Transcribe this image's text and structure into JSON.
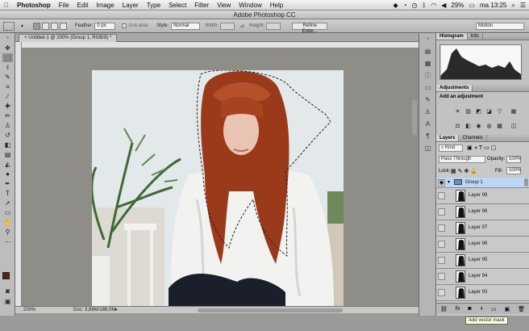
{
  "menubar": {
    "apple": "",
    "items": [
      "Photoshop",
      "File",
      "Edit",
      "Image",
      "Layer",
      "Type",
      "Select",
      "Filter",
      "View",
      "Window",
      "Help"
    ],
    "battery": "29%",
    "clock": "ma 13:25"
  },
  "window": {
    "title": "Adobe Photoshop CC"
  },
  "options": {
    "feather_label": "Feather:",
    "feather_value": "0 px",
    "antialias_label": "Anti-alias",
    "style_label": "Style:",
    "style_value": "Normal",
    "width_label": "Width:",
    "height_label": "Height:",
    "refine_edge": "Refine Edge...",
    "workspace": "Motion"
  },
  "document": {
    "tab": "Untitled-1 @ 200% (Group 1, RGB/8) *",
    "zoom": "200%",
    "doc_info": "Doc: 3,88M/186,0M"
  },
  "panels": {
    "histogram_tab": "Histogram",
    "info_tab": "Info",
    "adjustments_tab": "Adjustments",
    "adjustments_title": "Add an adjustment",
    "layers_tab": "Layers",
    "channels_tab": "Channels",
    "kind": "Kind",
    "blend_mode": "Pass Through",
    "opacity_label": "Opacity:",
    "opacity_value": "100%",
    "lock_label": "Lock:",
    "fill_label": "Fill:",
    "fill_value": "100%",
    "layers": [
      {
        "name": "Group 1",
        "selected": true
      },
      {
        "name": "Layer 99"
      },
      {
        "name": "Layer 98"
      },
      {
        "name": "Layer 97"
      },
      {
        "name": "Layer 96"
      },
      {
        "name": "Layer 95"
      },
      {
        "name": "Layer 94"
      },
      {
        "name": "Layer 93"
      }
    ]
  },
  "tooltip": "Add vector mask",
  "colors": {
    "selected_layer": "#bcd6f5",
    "canvas_bg": "#8f8d88"
  }
}
